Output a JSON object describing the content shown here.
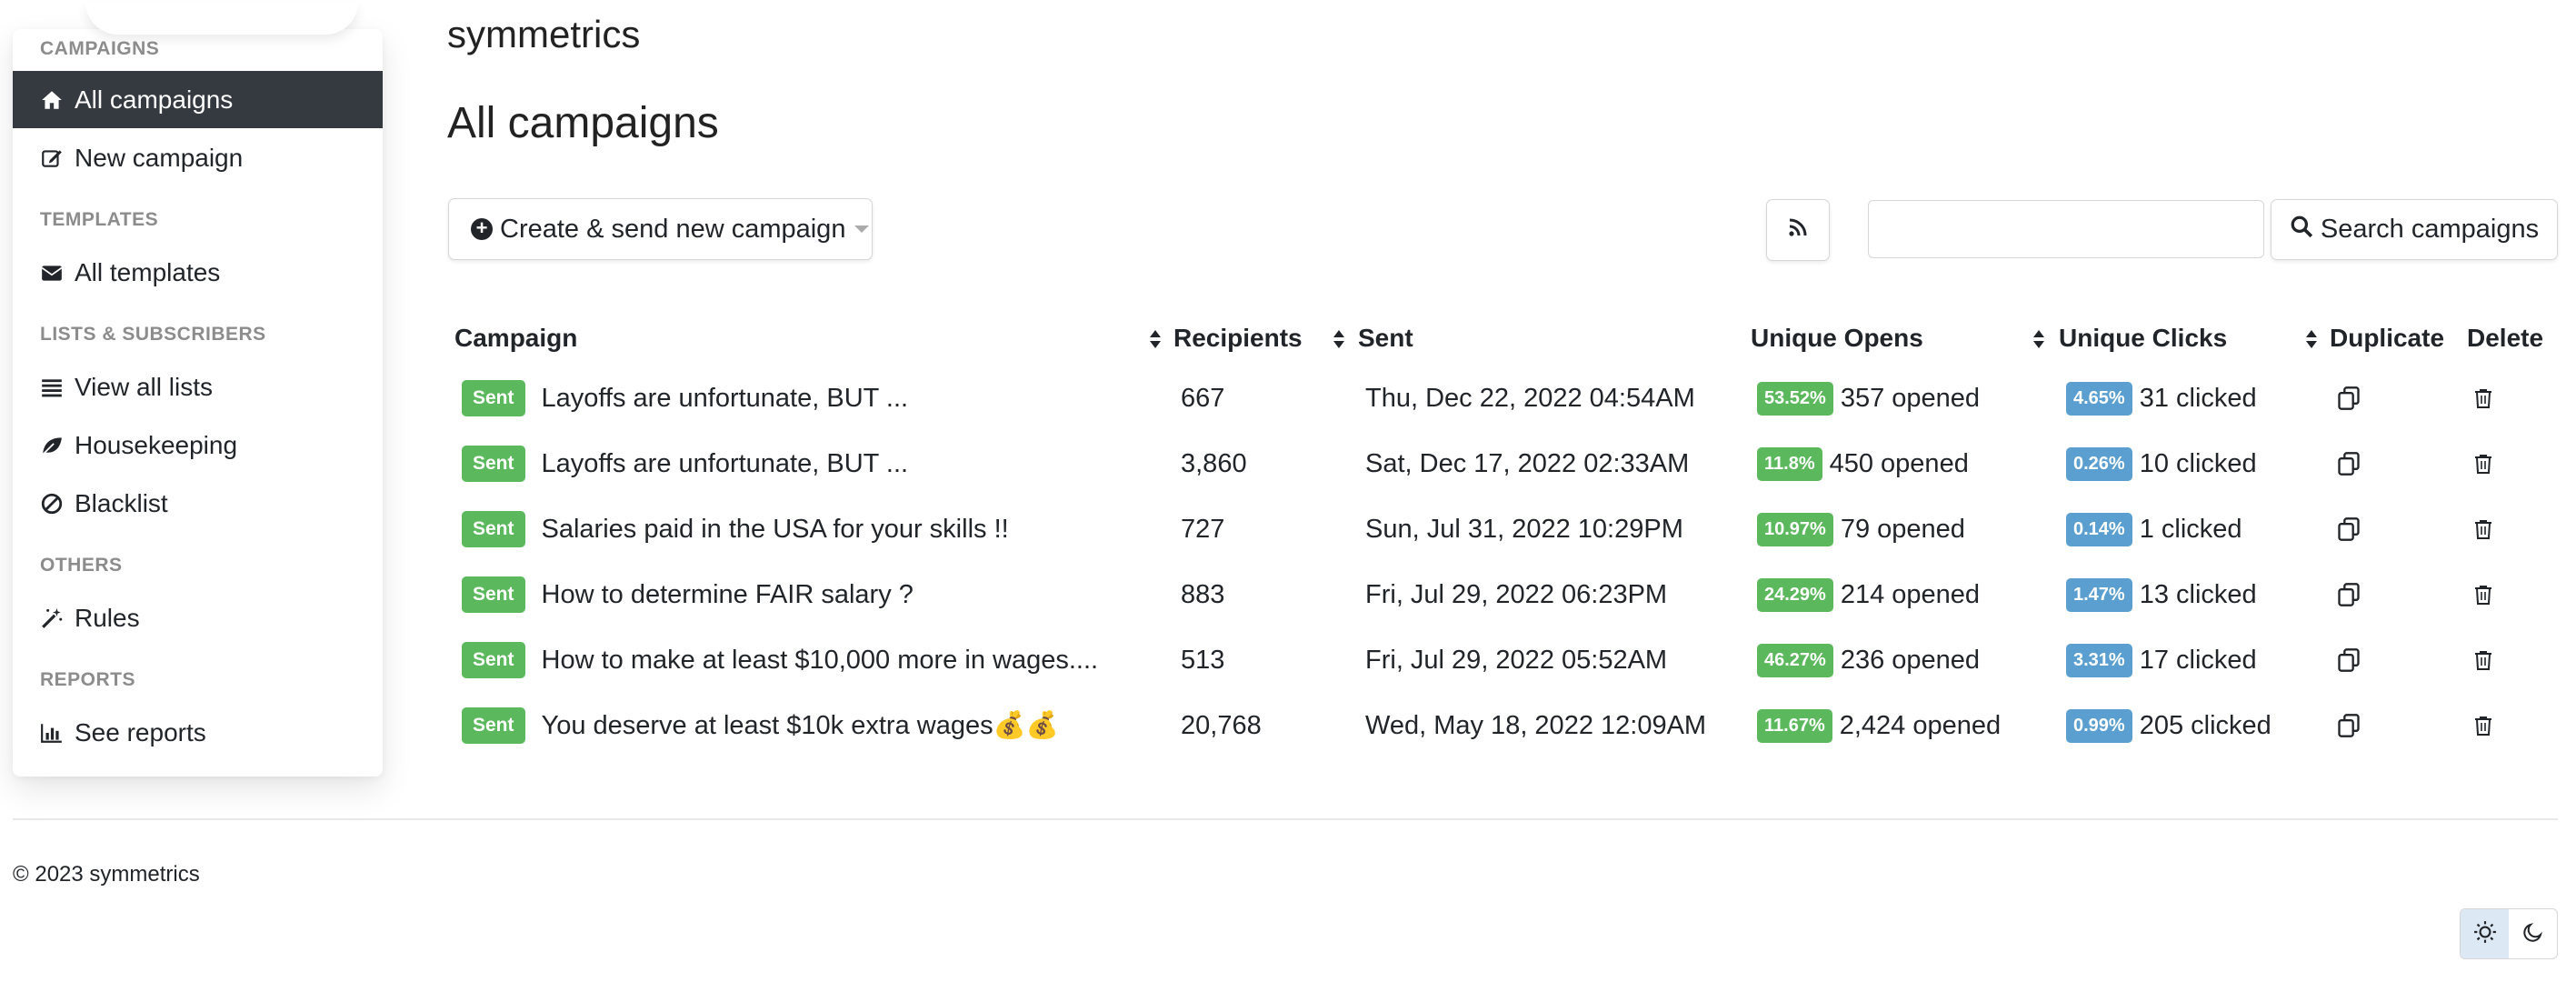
{
  "brand": "symmetrics",
  "page_title": "All campaigns",
  "sidebar": {
    "sections": [
      {
        "heading": "CAMPAIGNS",
        "items": [
          {
            "label": "All campaigns",
            "icon": "home-icon",
            "active": true
          },
          {
            "label": "New campaign",
            "icon": "edit-icon",
            "active": false
          }
        ]
      },
      {
        "heading": "TEMPLATES",
        "items": [
          {
            "label": "All templates",
            "icon": "envelope-icon",
            "active": false
          }
        ]
      },
      {
        "heading": "LISTS & SUBSCRIBERS",
        "items": [
          {
            "label": "View all lists",
            "icon": "list-icon",
            "active": false
          },
          {
            "label": "Housekeeping",
            "icon": "leaf-icon",
            "active": false
          },
          {
            "label": "Blacklist",
            "icon": "ban-icon",
            "active": false
          }
        ]
      },
      {
        "heading": "OTHERS",
        "items": [
          {
            "label": "Rules",
            "icon": "magic-wand-icon",
            "active": false
          }
        ]
      },
      {
        "heading": "REPORTS",
        "items": [
          {
            "label": "See reports",
            "icon": "bar-chart-icon",
            "active": false
          }
        ]
      }
    ]
  },
  "toolbar": {
    "create_label": "Create & send new campaign",
    "search_label": "Search campaigns",
    "search_value": ""
  },
  "table": {
    "headers": {
      "campaign": "Campaign",
      "recipients": "Recipients",
      "sent": "Sent",
      "unique_opens": "Unique Opens",
      "unique_clicks": "Unique Clicks",
      "duplicate": "Duplicate",
      "delete": "Delete"
    },
    "rows": [
      {
        "status": "Sent",
        "name": "Layoffs are unfortunate, BUT ...",
        "recipients": "667",
        "sent": "Thu, Dec 22, 2022 04:54AM",
        "open_pct": "53.52%",
        "opened": "357 opened",
        "click_pct": "4.65%",
        "clicked": "31 clicked"
      },
      {
        "status": "Sent",
        "name": "Layoffs are unfortunate, BUT ...",
        "recipients": "3,860",
        "sent": "Sat, Dec 17, 2022 02:33AM",
        "open_pct": "11.8%",
        "opened": "450 opened",
        "click_pct": "0.26%",
        "clicked": "10 clicked"
      },
      {
        "status": "Sent",
        "name": "Salaries paid in the USA for your skills !!",
        "recipients": "727",
        "sent": "Sun, Jul 31, 2022 10:29PM",
        "open_pct": "10.97%",
        "opened": "79 opened",
        "click_pct": "0.14%",
        "clicked": "1 clicked"
      },
      {
        "status": "Sent",
        "name": "How to determine FAIR salary ?",
        "recipients": "883",
        "sent": "Fri, Jul 29, 2022 06:23PM",
        "open_pct": "24.29%",
        "opened": "214 opened",
        "click_pct": "1.47%",
        "clicked": "13 clicked"
      },
      {
        "status": "Sent",
        "name": "How to make at least $10,000 more in wages....",
        "recipients": "513",
        "sent": "Fri, Jul 29, 2022 05:52AM",
        "open_pct": "46.27%",
        "opened": "236 opened",
        "click_pct": "3.31%",
        "clicked": "17 clicked"
      },
      {
        "status": "Sent",
        "name": "You deserve at least $10k extra wages💰💰",
        "recipients": "20,768",
        "sent": "Wed, May 18, 2022 12:09AM",
        "open_pct": "11.67%",
        "opened": "2,424 opened",
        "click_pct": "0.99%",
        "clicked": "205 clicked"
      }
    ]
  },
  "footer": {
    "copyright": "© 2023 symmetrics"
  },
  "theme": {
    "active": "light"
  },
  "colors": {
    "sidebar_active_bg": "#343a40",
    "badge_green": "#5cb85c",
    "badge_blue": "#5b9fd1"
  }
}
